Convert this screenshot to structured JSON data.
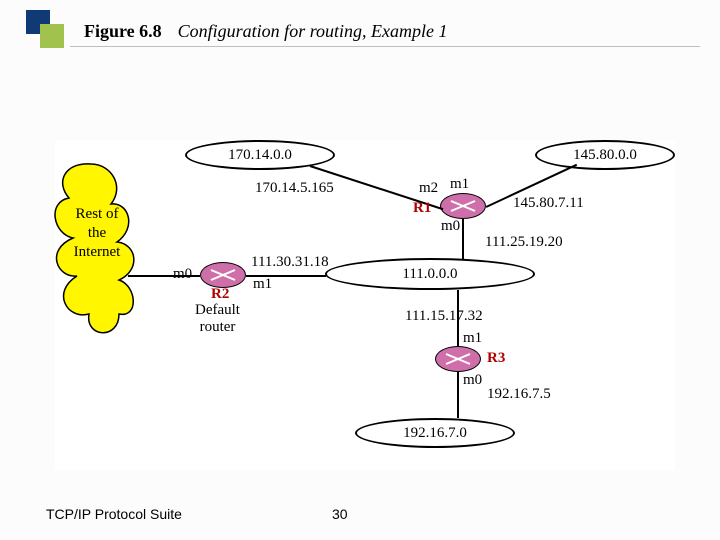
{
  "header": {
    "figure_label": "Figure 6.8",
    "figure_title": "Configuration for routing, Example 1"
  },
  "diagram": {
    "cloud": {
      "text": "Rest\nof\nthe\nInternet"
    },
    "networks": {
      "n170_14": "170.14.0.0",
      "n145_80": "145.80.0.0",
      "n111": "111.0.0.0",
      "n192_16": "192.16.7.0"
    },
    "routers": {
      "r1": "R1",
      "r2": "R2",
      "r3": "R3",
      "default_caption": "Default\nrouter"
    },
    "iface": {
      "r1_m0": "m0",
      "r1_m1": "m1",
      "r1_m2": "m2",
      "r2_m0": "m0",
      "r2_m1": "m1",
      "r3_m0": "m0",
      "r3_m1": "m1"
    },
    "addrs": {
      "n170_r1": "170.14.5.165",
      "n145_r1": "145.80.7.11",
      "r1_n111": "111.25.19.20",
      "r2_n111": "111.30.31.18",
      "n111_r3": "111.15.17.32",
      "r3_n192": "192.16.7.5"
    }
  },
  "footer": {
    "text": "TCP/IP Protocol Suite",
    "pagenum": "30"
  }
}
